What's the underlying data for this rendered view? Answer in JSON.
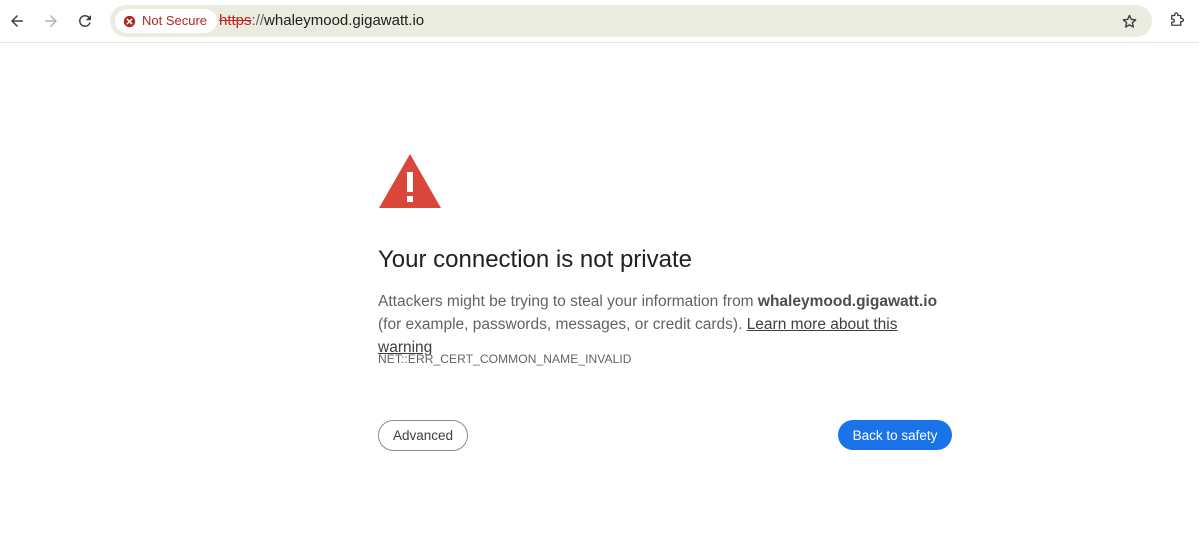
{
  "toolbar": {
    "back_icon": "arrow-left-icon",
    "forward_icon": "arrow-right-icon",
    "reload_icon": "reload-icon",
    "security_label": "Not Secure",
    "security_icon": "error-circle-icon",
    "url_scheme": "https",
    "url_separator": "://",
    "url_host": "whaleymood.gigawatt.io",
    "bookmark_icon": "star-icon",
    "extensions_icon": "puzzle-icon"
  },
  "interstitial": {
    "icon": "warning-triangle-icon",
    "heading": "Your connection is not private",
    "body_prefix": "Attackers might be trying to steal your information from ",
    "body_host": "whaleymood.gigawatt.io",
    "body_suffix": " (for example, passwords, messages, or credit cards). ",
    "learn_more": "Learn more about this warning",
    "error_code": "NET::ERR_CERT_COMMON_NAME_INVALID",
    "advanced_label": "Advanced",
    "back_label": "Back to safety"
  },
  "colors": {
    "danger": "#c5221f",
    "primary_button": "#1a73e8",
    "warning_icon": "#d9473b"
  }
}
